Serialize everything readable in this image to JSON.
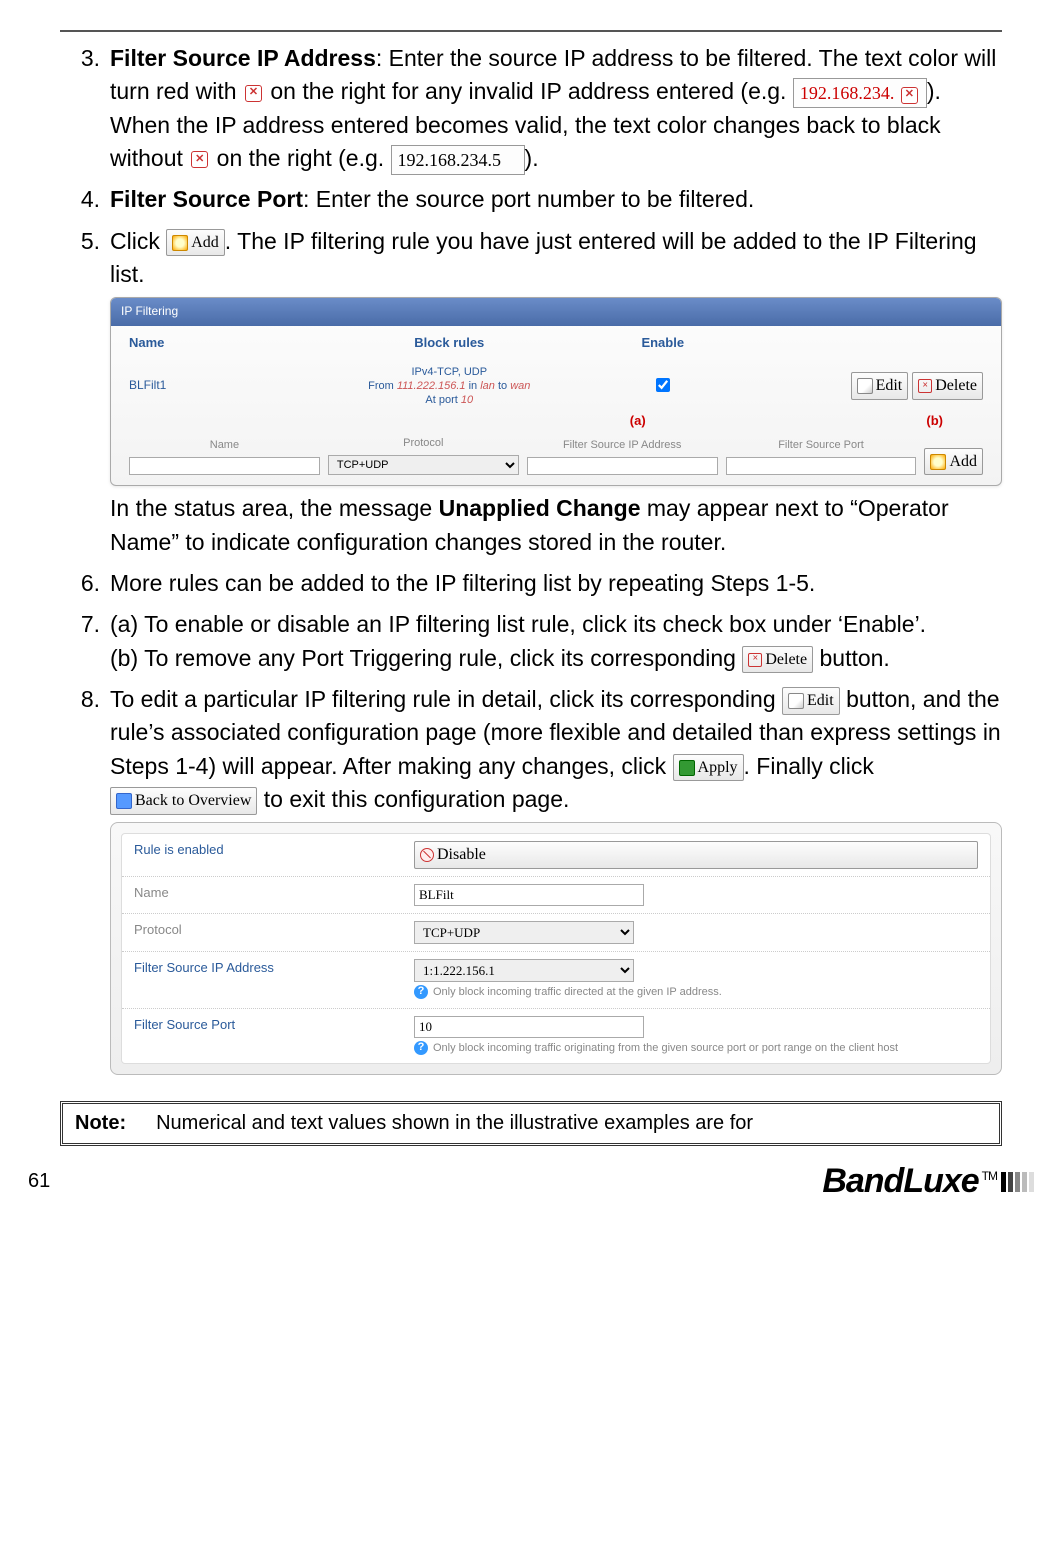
{
  "items": {
    "i3": {
      "n": "3.",
      "title": "Filter Source IP Address",
      "t1": ": Enter the source IP address to be filtered. The text color will turn red with",
      "t2": "on the right for any invalid IP address entered (e.g.",
      "ip_bad": "192.168.234.",
      "t3": "). When the IP address entered becomes valid, the text color changes back to black without",
      "t4": "on the right (e.g.",
      "ip_good": "192.168.234.5",
      "t5": ")."
    },
    "i4": {
      "n": "4.",
      "title": "Filter Source Port",
      "t": ": Enter the source port number to be filtered."
    },
    "i5": {
      "n": "5.",
      "t1": "Click",
      "t2": ". The IP filtering rule you have just entered will be added to the IP Filtering list.",
      "after1": "In the status area, the message ",
      "unapp": "Unapplied Change",
      "after2": " may appear next to “Operator Name” to indicate configuration changes stored in the router."
    },
    "i6": {
      "n": "6.",
      "t": "More rules can be added to the IP filtering list by repeating Steps 1-5."
    },
    "i7": {
      "n": "7.",
      "a": "(a) To enable or disable an IP filtering list rule, click its check box under ‘Enable’.",
      "b": "(b) To remove any Port Triggering rule, click its corresponding",
      "b2": " button."
    },
    "i8": {
      "n": "8.",
      "t1": "To edit a particular IP filtering rule in detail, click its corresponding",
      "t2": " button, and the rule’s associated configuration page (more flexible and detailed than express settings in Steps 1-4) will appear. After making any changes, click ",
      "t3": ". Finally click ",
      "t4": " to exit this configuration page."
    }
  },
  "btns": {
    "add": "Add",
    "edit": "Edit",
    "delete": "Delete",
    "apply": "Apply",
    "back": "Back to Overview",
    "disable": "Disable"
  },
  "ss": {
    "title": "IP Filtering",
    "hdr": {
      "name": "Name",
      "rules": "Block rules",
      "enable": "Enable"
    },
    "row": {
      "name": "BLFilt1",
      "line1": "IPv4-TCP, UDP",
      "line2a": "From ",
      "line2ip": "111.222.156.1",
      "line2b": " in ",
      "line2lan": "lan",
      "line2c": " to ",
      "line2wan": "wan",
      "line3a": "At port ",
      "line3p": "10"
    },
    "ann": {
      "a": "(a)",
      "b": "(b)"
    },
    "inp": {
      "name": "Name",
      "proto": "Protocol",
      "proto_val": "TCP+UDP",
      "src": "Filter Source IP Address",
      "port": "Filter Source Port"
    }
  },
  "cfg": {
    "r1": {
      "l": "Rule is enabled"
    },
    "r2": {
      "l": "Name",
      "v": "BLFilt"
    },
    "r3": {
      "l": "Protocol",
      "v": "TCP+UDP"
    },
    "r4": {
      "l": "Filter Source IP Address",
      "v": "1:1.222.156.1",
      "h": "Only block incoming traffic directed at the given IP address."
    },
    "r5": {
      "l": "Filter Source Port",
      "v": "10",
      "h": "Only block incoming traffic originating from the given source port or port range on the client host"
    }
  },
  "note": {
    "label": "Note:",
    "text": "Numerical and text values shown in the illustrative examples are for"
  },
  "footer": {
    "page": "61",
    "brand": "BandLuxe",
    "tm": "TM"
  }
}
